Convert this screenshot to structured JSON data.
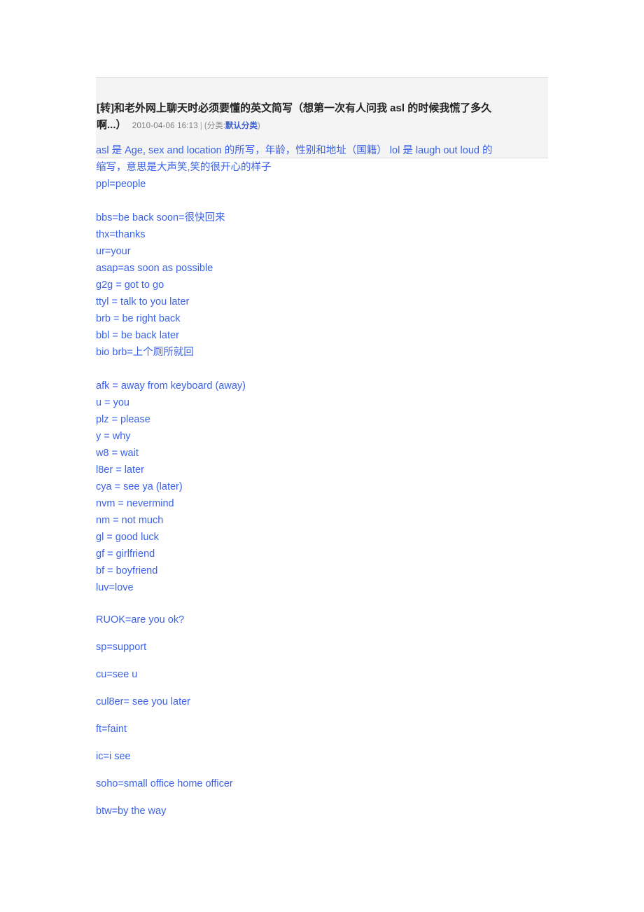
{
  "post": {
    "title_line1": "[转]和老外网上聊天时必须要懂的英文简写（想第一次有人问我 ",
    "title_asl": "asl",
    "title_line1_end": " 的时候我慌了多久",
    "title_line2": "啊...）",
    "date": "2010-04-06  16:13",
    "separator": "|",
    "category_prefix": "(分类:",
    "category_name": "默认分类",
    "category_suffix": ")"
  },
  "body": {
    "intro": [
      "asl 是 Age, sex and location 的所写，年龄，性别和地址（国籍） lol 是 laugh out loud 的",
      "缩写，意思是大声笑,笑的很开心的样子",
      "ppl=people"
    ],
    "block1": [
      "bbs=be back soon=很快回来",
      "thx=thanks",
      "ur=your",
      "asap=as soon as possible",
      "g2g = got to go",
      "ttyl = talk to you later",
      "brb = be right back",
      "bbl = be back later",
      "bio brb=上个厕所就回"
    ],
    "block2": [
      "afk = away from keyboard (away)",
      "u = you",
      "plz = please",
      "y = why",
      "w8 = wait",
      "l8er = later",
      "cya = see ya (later)",
      "nvm = nevermind",
      "nm = not much",
      "gl = good luck",
      "gf = girlfriend",
      "bf = boyfriend",
      "luv=love"
    ],
    "block3": [
      "RUOK=are you ok?",
      "sp=support",
      "cu=see u",
      "cul8er= see you later",
      "ft=faint",
      "ic=i see",
      "soho=small office home officer",
      "btw=by the way"
    ]
  },
  "colors": {
    "body_text": "#3a62e8",
    "title_text": "#232323",
    "meta_text": "#7a7a7a",
    "link": "#3b5fd0",
    "header_bg": "#f4f4f4",
    "page_bg": "#ffffff"
  }
}
